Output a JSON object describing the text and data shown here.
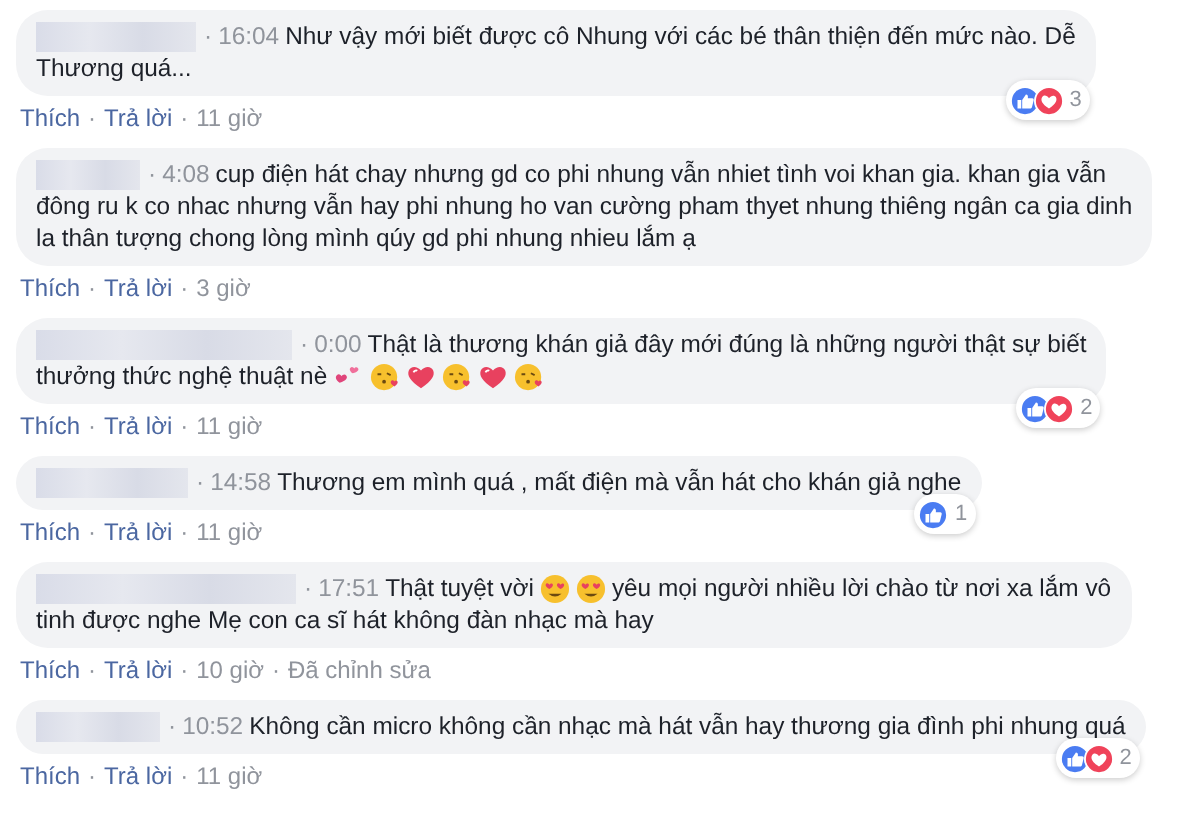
{
  "comments": [
    {
      "dot": "·",
      "time": "16:04",
      "lines": [
        [
          {
            "kind": "text",
            "text": "Như vậy mới biết được cô Nhung với các bé thân thiện đến mức nào. Dễ"
          }
        ],
        [
          {
            "kind": "text",
            "text": "Thương quá..."
          }
        ]
      ],
      "footer": [
        {
          "kind": "link",
          "text": "Thích"
        },
        {
          "kind": "dot",
          "text": "·"
        },
        {
          "kind": "link",
          "text": "Trả lời"
        },
        {
          "kind": "dot",
          "text": "·"
        },
        {
          "kind": "age",
          "text": "11 giờ"
        }
      ],
      "reactions": {
        "icons": [
          {
            "kind": "like"
          },
          {
            "kind": "love"
          }
        ],
        "count": "3"
      }
    },
    {
      "dot": "·",
      "time": "4:08",
      "lines": [
        [
          {
            "kind": "text",
            "text": "cup điện hát chay nhưng gd co phi nhung vẫn nhiet tình voi khan gia. khan gia vẫn"
          }
        ],
        [
          {
            "kind": "text",
            "text": "đông ru k co nhac nhưng vẫn hay phi nhung ho van cường pham thyet nhung thiêng ngân ca gia dinh"
          }
        ],
        [
          {
            "kind": "text",
            "text": "la thân tượng chong lòng mình qúy gd phi nhung nhieu lắm ạ"
          }
        ]
      ],
      "footer": [
        {
          "kind": "link",
          "text": "Thích"
        },
        {
          "kind": "dot",
          "text": "·"
        },
        {
          "kind": "link",
          "text": "Trả lời"
        },
        {
          "kind": "dot",
          "text": "·"
        },
        {
          "kind": "age",
          "text": "3 giờ"
        }
      ]
    },
    {
      "dot": "·",
      "time": "0:00",
      "lines": [
        [
          {
            "kind": "text",
            "text": "Thật là thương khán giả đây mới đúng là những người thật sự biết"
          }
        ],
        [
          {
            "kind": "text",
            "text": "thưởng thức nghệ thuật nè"
          },
          {
            "kind": "hearts"
          },
          {
            "kind": "kiss"
          },
          {
            "kind": "heart"
          },
          {
            "kind": "kiss"
          },
          {
            "kind": "heart"
          },
          {
            "kind": "kiss"
          }
        ]
      ],
      "footer": [
        {
          "kind": "link",
          "text": "Thích"
        },
        {
          "kind": "dot",
          "text": "·"
        },
        {
          "kind": "link",
          "text": "Trả lời"
        },
        {
          "kind": "dot",
          "text": "·"
        },
        {
          "kind": "age",
          "text": "11 giờ"
        }
      ],
      "reactions": {
        "icons": [
          {
            "kind": "like"
          },
          {
            "kind": "love"
          }
        ],
        "count": "2"
      }
    },
    {
      "dot": "·",
      "time": "14:58",
      "lines": [
        [
          {
            "kind": "text",
            "text": "Thương em mình quá , mất điện mà vẫn hát cho khán giả nghe"
          }
        ]
      ],
      "footer": [
        {
          "kind": "link",
          "text": "Thích"
        },
        {
          "kind": "dot",
          "text": "·"
        },
        {
          "kind": "link",
          "text": "Trả lời"
        },
        {
          "kind": "dot",
          "text": "·"
        },
        {
          "kind": "age",
          "text": "11 giờ"
        }
      ],
      "reactions": {
        "icons": [
          {
            "kind": "like"
          }
        ],
        "count": "1"
      }
    },
    {
      "dot": "·",
      "time": "17:51",
      "lines": [
        [
          {
            "kind": "text",
            "text": "Thật tuyệt vời"
          },
          {
            "kind": "heart-eyes"
          },
          {
            "kind": "heart-eyes"
          },
          {
            "kind": "text",
            "text": "yêu mọi người nhiều lời chào từ nơi xa lắm vô"
          }
        ],
        [
          {
            "kind": "text",
            "text": "tinh được nghe Mẹ con ca sĩ hát không đàn nhạc mà hay"
          }
        ]
      ],
      "footer": [
        {
          "kind": "link",
          "text": "Thích"
        },
        {
          "kind": "dot",
          "text": "·"
        },
        {
          "kind": "link",
          "text": "Trả lời"
        },
        {
          "kind": "dot",
          "text": "·"
        },
        {
          "kind": "age",
          "text": "10 giờ"
        },
        {
          "kind": "dot",
          "text": "·"
        },
        {
          "kind": "age",
          "text": "Đã chỉnh sửa"
        }
      ]
    },
    {
      "dot": "·",
      "time": "10:52",
      "lines": [
        [
          {
            "kind": "text",
            "text": "Không cần micro không cần nhạc mà hát vẫn hay thương gia đình phi nhung quá"
          }
        ]
      ],
      "footer": [
        {
          "kind": "link",
          "text": "Thích"
        },
        {
          "kind": "dot",
          "text": "·"
        },
        {
          "kind": "link",
          "text": "Trả lời"
        },
        {
          "kind": "dot",
          "text": "·"
        },
        {
          "kind": "age",
          "text": "11 giờ"
        }
      ],
      "reactions": {
        "icons": [
          {
            "kind": "like"
          },
          {
            "kind": "love"
          }
        ],
        "count": "2"
      }
    }
  ]
}
